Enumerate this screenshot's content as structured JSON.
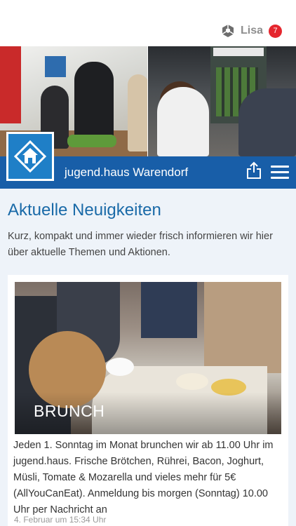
{
  "topbar": {
    "user_name": "Lisa",
    "notification_count": "7",
    "logo_icon": "cube-logo-icon",
    "badge_color": "#e5262e"
  },
  "hero": {
    "description_icon": "hero-photo"
  },
  "navbar": {
    "title": "jugend.haus Warendorf",
    "color": "#185ea8",
    "share_icon": "share-icon",
    "menu_icon": "hamburger-menu-icon",
    "logo_icon": "house-logo-icon"
  },
  "main": {
    "section_title": "Aktuelle Neuigkeiten",
    "intro": "Kurz, kompakt und immer wieder frisch informieren wir hier über aktuelle Themen und Aktionen.",
    "accent_color": "#1a6aa8"
  },
  "news": [
    {
      "label": "BRUNCH",
      "text": "Jeden 1. Sonntag im Monat brunchen wir ab 11.00 Uhr im jugend.haus. Frische Brötchen, Rührei, Bacon, Joghurt, Müsli, Tomate & Mozarella und vieles mehr für 5€ (AllYouCanEat). Anmeldung bis morgen (Sonntag) 10.00 Uhr per Nachricht an",
      "date": "4. Februar um 15:34 Uhr"
    }
  ]
}
